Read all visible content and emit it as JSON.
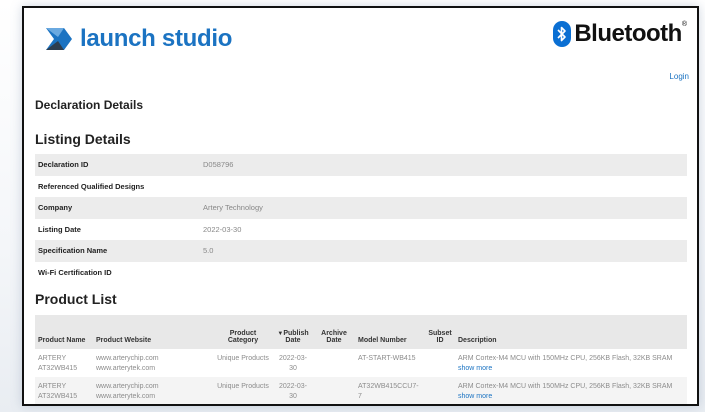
{
  "header": {
    "logo_text": "launch studio",
    "brand_text": "Bluetooth",
    "brand_reg": "®",
    "login": "Login"
  },
  "colors": {
    "accent": "#1b73c2",
    "bluetooth_badge": "#0a6fd3",
    "row_alt": "#ececec"
  },
  "icons": [
    "launch-studio-logo-icon",
    "bluetooth-rune-icon"
  ],
  "declaration": {
    "title": "Declaration Details"
  },
  "listing": {
    "title": "Listing Details",
    "rows": [
      {
        "label": "Declaration ID",
        "value": "D058796"
      },
      {
        "label": "Referenced Qualified Designs",
        "value": ""
      },
      {
        "label": "Company",
        "value": "Artery Technology"
      },
      {
        "label": "Listing Date",
        "value": "2022-03-30"
      },
      {
        "label": "Specification Name",
        "value": "5.0"
      },
      {
        "label": "Wi-Fi Certification ID",
        "value": ""
      }
    ]
  },
  "products": {
    "title": "Product List",
    "columns": [
      "Product Name",
      "Product Website",
      "Product Category",
      "Publish Date",
      "Archive Date",
      "Model Number",
      "Subset ID",
      "Description"
    ],
    "sort_indicator": "▼",
    "rows": [
      {
        "name": "ARTERY AT32WB415",
        "website": "www.arterychip.com www.arterytek.com",
        "category": "Unique Products",
        "publish": "2022-03-30",
        "archive": "",
        "model": "AT-START-WB415",
        "subset": "",
        "description": "ARM Cortex-M4 MCU with 150MHz CPU, 256KB Flash, 32KB SRAM",
        "show_more": "show more"
      },
      {
        "name": "ARTERY AT32WB415",
        "website": "www.arterychip.com www.arterytek.com",
        "category": "Unique Products",
        "publish": "2022-03-30",
        "archive": "",
        "model": "AT32WB415CCU7-7",
        "subset": "",
        "description": "ARM Cortex-M4 MCU with 150MHz CPU, 256KB Flash, 32KB SRAM",
        "show_more": "show more"
      }
    ]
  }
}
